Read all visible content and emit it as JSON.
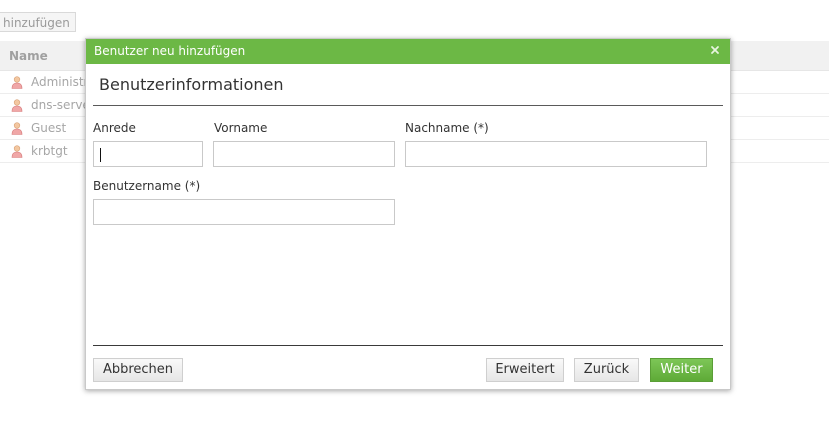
{
  "background": {
    "add_button_label": "hinzufügen",
    "grid": {
      "column_name": "Name",
      "rows": [
        {
          "name": "Administra"
        },
        {
          "name": "dns-serve"
        },
        {
          "name": "Guest"
        },
        {
          "name": "krbtgt"
        }
      ]
    }
  },
  "dialog": {
    "title": "Benutzer neu hinzufügen",
    "section_title": "Benutzerinformationen",
    "fields": {
      "anrede": {
        "label": "Anrede",
        "value": ""
      },
      "vorname": {
        "label": "Vorname",
        "value": ""
      },
      "nachname": {
        "label": "Nachname (*)",
        "value": ""
      },
      "benutzername": {
        "label": "Benutzername (*)",
        "value": ""
      }
    },
    "buttons": {
      "cancel": "Abbrechen",
      "advanced": "Erweitert",
      "back": "Zurück",
      "next": "Weiter"
    }
  },
  "colors": {
    "titlebar": "#6cb845",
    "primary_button": "#6cb845"
  },
  "icons": {
    "user": "user-icon",
    "close": "close-icon"
  }
}
